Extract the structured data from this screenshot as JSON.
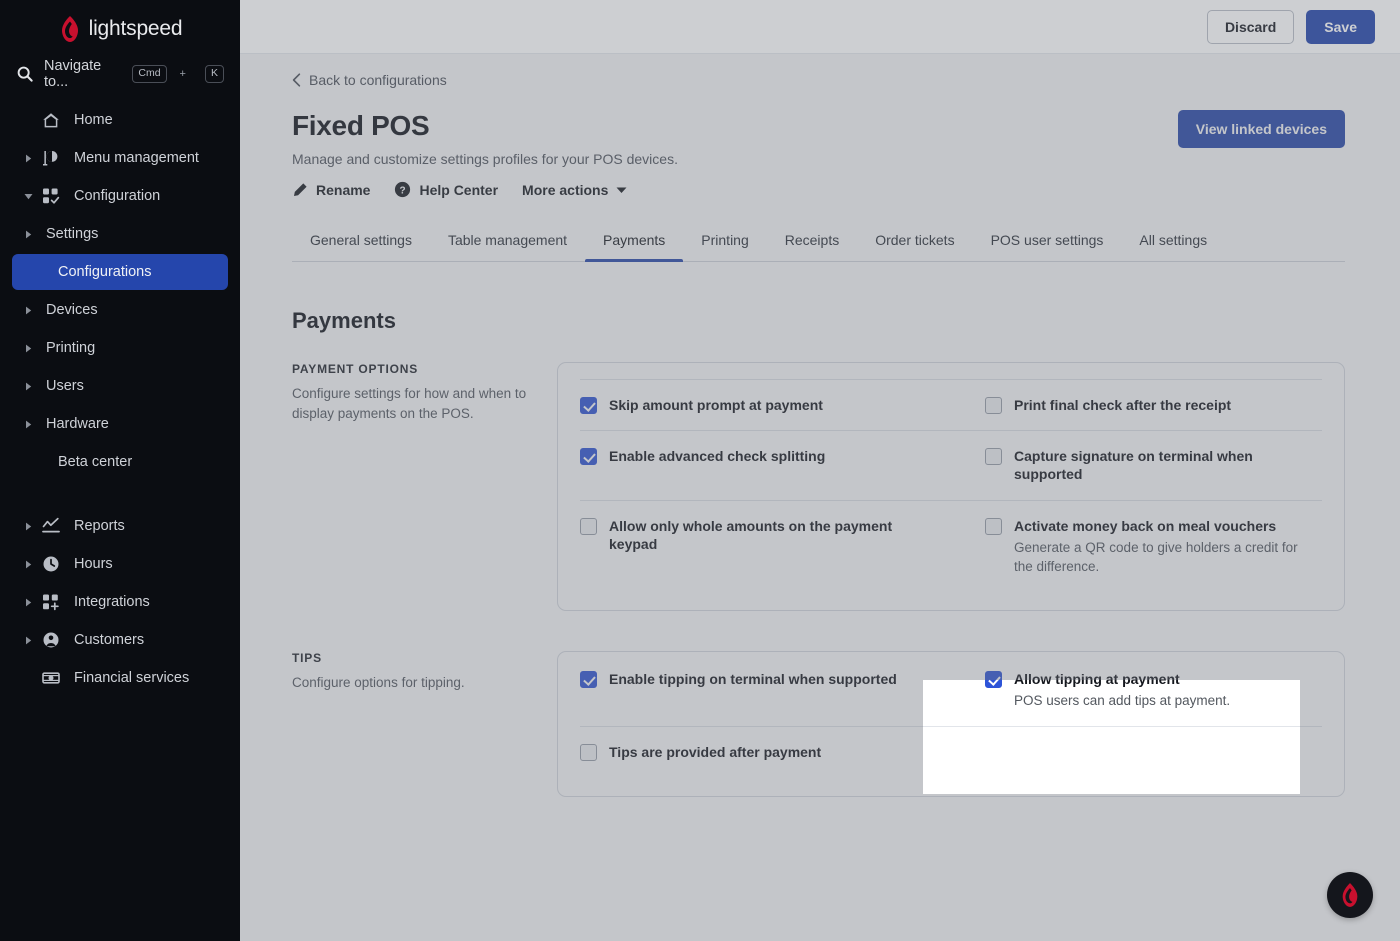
{
  "sidebar": {
    "brand": "lightspeed",
    "search": {
      "label": "Navigate to...",
      "key1": "Cmd",
      "plus": "+",
      "key2": "K"
    },
    "items": [
      {
        "label": "Home",
        "icon": "home-icon",
        "arrow": false,
        "level": 0,
        "active": false
      },
      {
        "label": "Menu management",
        "icon": "menu-icon",
        "arrow": true,
        "level": 0,
        "active": false
      },
      {
        "label": "Configuration",
        "icon": "configuration-icon",
        "arrow": true,
        "level": 0,
        "active": false,
        "expanded": true
      },
      {
        "label": "Settings",
        "icon": null,
        "arrow": true,
        "level": 1,
        "active": false
      },
      {
        "label": "Configurations",
        "icon": null,
        "arrow": false,
        "level": 1,
        "active": true
      },
      {
        "label": "Devices",
        "icon": null,
        "arrow": true,
        "level": 1,
        "active": false
      },
      {
        "label": "Printing",
        "icon": null,
        "arrow": true,
        "level": 1,
        "active": false
      },
      {
        "label": "Users",
        "icon": null,
        "arrow": true,
        "level": 1,
        "active": false
      },
      {
        "label": "Hardware",
        "icon": null,
        "arrow": true,
        "level": 1,
        "active": false
      },
      {
        "label": "Beta center",
        "icon": null,
        "arrow": false,
        "level": 1,
        "active": false
      },
      {
        "label": "Reports",
        "icon": "reports-icon",
        "arrow": true,
        "level": 0,
        "active": false
      },
      {
        "label": "Hours",
        "icon": "clock-icon",
        "arrow": true,
        "level": 0,
        "active": false
      },
      {
        "label": "Integrations",
        "icon": "integrations-icon",
        "arrow": true,
        "level": 0,
        "active": false
      },
      {
        "label": "Customers",
        "icon": "customers-icon",
        "arrow": true,
        "level": 0,
        "active": false
      },
      {
        "label": "Financial services",
        "icon": "money-icon",
        "arrow": false,
        "level": 0,
        "active": false
      }
    ]
  },
  "topbar": {
    "discard_label": "Discard",
    "save_label": "Save"
  },
  "page": {
    "back_label": "Back to configurations",
    "title": "Fixed POS",
    "subtitle": "Manage and customize settings profiles for your POS devices.",
    "actions": [
      {
        "label": "Rename",
        "icon": "pencil-icon"
      },
      {
        "label": "Help Center",
        "icon": "help-circle-icon"
      },
      {
        "label": "More actions",
        "icon": "chevron-down-icon"
      }
    ],
    "view_linked_devices": "View linked devices",
    "tabs": [
      {
        "label": "General settings",
        "active": false
      },
      {
        "label": "Table management",
        "active": false
      },
      {
        "label": "Payments",
        "active": true
      },
      {
        "label": "Printing",
        "active": false
      },
      {
        "label": "Receipts",
        "active": false
      },
      {
        "label": "Order tickets",
        "active": false
      },
      {
        "label": "POS user settings",
        "active": false
      },
      {
        "label": "All settings",
        "active": false
      }
    ],
    "section_heading": "Payments"
  },
  "payment_options": {
    "label": "Payment options",
    "description": "Configure settings for how and when to display payments on the POS.",
    "rows": [
      {
        "left": {
          "label": "Skip amount prompt at payment",
          "checked": true,
          "sub": ""
        },
        "right": {
          "label": "Print final check after the receipt",
          "checked": false,
          "sub": ""
        }
      },
      {
        "left": {
          "label": "Enable advanced check splitting",
          "checked": true,
          "sub": ""
        },
        "right": {
          "label": "Capture signature on terminal when supported",
          "checked": false,
          "sub": ""
        }
      },
      {
        "left": {
          "label": "Allow only whole amounts on the payment keypad",
          "checked": false,
          "sub": ""
        },
        "right": {
          "label": "Activate money back on meal vouchers",
          "checked": false,
          "sub": "Generate a QR code to give holders a credit for the difference."
        }
      }
    ]
  },
  "tips": {
    "label": "Tips",
    "description": "Configure options for tipping.",
    "rows": [
      {
        "left": {
          "label": "Enable tipping on terminal when supported",
          "checked": true,
          "sub": ""
        },
        "right": {
          "label": "Allow tipping at payment",
          "checked": true,
          "sub": "POS users can add tips at payment."
        }
      },
      {
        "left": {
          "label": "Tips are provided after payment",
          "checked": false,
          "sub": ""
        },
        "right": {
          "label": "",
          "checked": false,
          "sub": ""
        }
      }
    ]
  },
  "fab": {
    "icon": "lightspeed-flame-icon"
  },
  "colors": {
    "accent": "#2546ac",
    "checkbox_on": "#2d54d8",
    "sidebar_bg": "#0b0d12",
    "brand_flame": "#c8102e",
    "overlay": "rgba(108,113,122,0.40)"
  }
}
